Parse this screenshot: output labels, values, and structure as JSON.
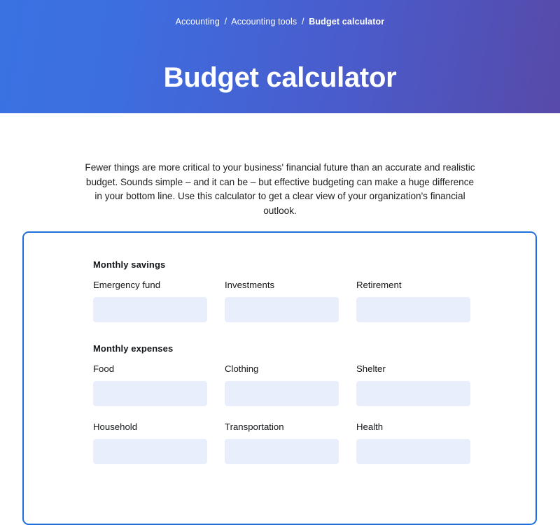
{
  "hero": {
    "breadcrumb": [
      {
        "label": "Accounting",
        "current": false
      },
      {
        "label": "Accounting tools",
        "current": false
      },
      {
        "label": "Budget calculator",
        "current": true
      }
    ],
    "separator": "/",
    "title": "Budget calculator",
    "gradient_from": "#3a72e2",
    "gradient_to": "#574aa9"
  },
  "intro": {
    "paragraph": "Fewer things are more critical to your business' financial future than an accurate and realistic budget. Sounds simple – and it can be – but effective budgeting can make a huge difference in your bottom line. Use this calculator to get a clear view of your organization's financial outlook."
  },
  "card": {
    "border_color": "#1f6fde",
    "input_background": "#e8eefb",
    "sections": [
      {
        "title": "Monthly savings",
        "fields": [
          {
            "label": "Emergency fund",
            "value": "",
            "placeholder": ""
          },
          {
            "label": "Investments",
            "value": "",
            "placeholder": ""
          },
          {
            "label": "Retirement",
            "value": "",
            "placeholder": ""
          }
        ]
      },
      {
        "title": "Monthly expenses",
        "fields": [
          {
            "label": "Food",
            "value": "",
            "placeholder": ""
          },
          {
            "label": "Clothing",
            "value": "",
            "placeholder": ""
          },
          {
            "label": "Shelter",
            "value": "",
            "placeholder": ""
          },
          {
            "label": "Household",
            "value": "",
            "placeholder": ""
          },
          {
            "label": "Transportation",
            "value": "",
            "placeholder": ""
          },
          {
            "label": "Health",
            "value": "",
            "placeholder": ""
          }
        ]
      }
    ]
  }
}
